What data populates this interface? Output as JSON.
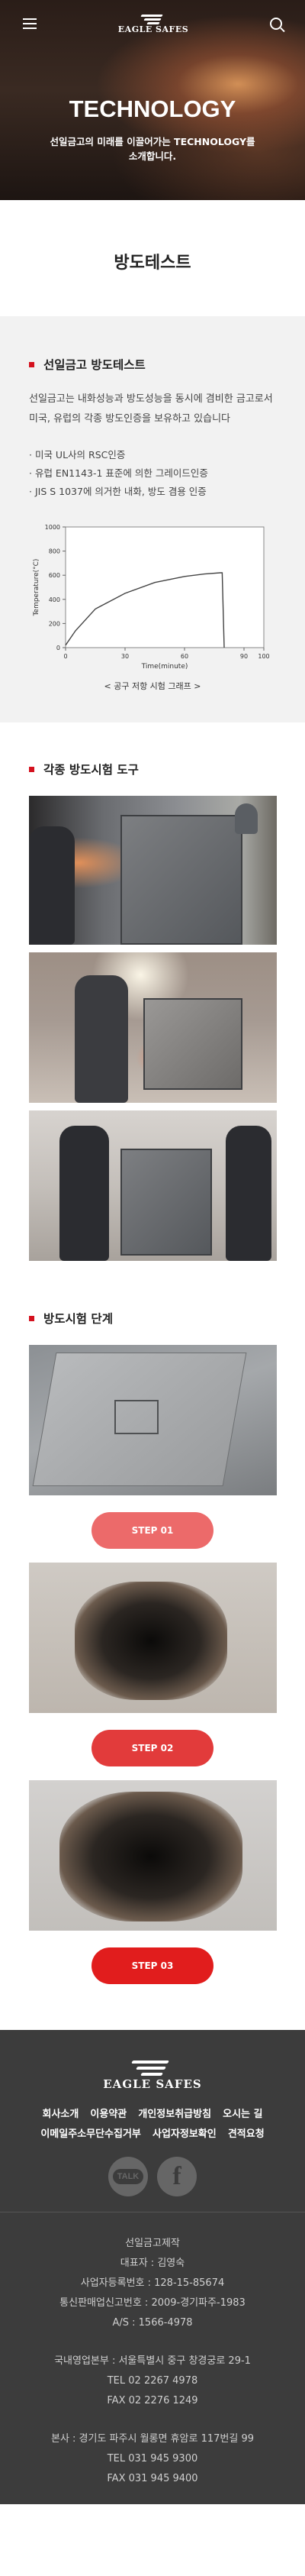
{
  "header": {
    "logo_text": "EAGLE SAFES"
  },
  "hero": {
    "title": "TECHNOLOGY",
    "subtitle": "선일금고의 미래를 이끌어가는 TECHNOLOGY를 소개합니다."
  },
  "page_title": "방도테스트",
  "section_test": {
    "heading": "선일금고 방도테스트",
    "description": "선일금고는 내화성능과 방도성능을 동시에 겸비한 금고로서 미국, 유럽의 각종 방도인증을 보유하고 있습니다",
    "bullets": [
      "미국 UL사의 RSC인증",
      "유럽 EN1143-1 표준에 의한 그레이드인증",
      "JIS S 1037에 의거한 내화, 방도 겸용 인증"
    ],
    "chart_caption": "< 공구 저항 시험 그래프 >"
  },
  "chart_data": {
    "type": "line",
    "title": "",
    "xlabel": "Time(minute)",
    "ylabel": "Temperature(°C)",
    "xlim": [
      0,
      100
    ],
    "ylim": [
      0,
      1000
    ],
    "x_ticks": [
      0,
      30,
      60,
      90,
      100
    ],
    "y_ticks": [
      0,
      200,
      400,
      600,
      800,
      1000
    ],
    "grid": false,
    "series": [
      {
        "values": [
          [
            0,
            20
          ],
          [
            5,
            140
          ],
          [
            15,
            320
          ],
          [
            30,
            450
          ],
          [
            45,
            540
          ],
          [
            60,
            590
          ],
          [
            70,
            610
          ],
          [
            78,
            620
          ],
          [
            79,
            620
          ],
          [
            80,
            0
          ]
        ]
      }
    ],
    "colors": {
      "line": "#444444"
    }
  },
  "section_tools": {
    "heading": "각종 방도시험 도구"
  },
  "section_steps": {
    "heading": "방도시험 단계",
    "steps": [
      {
        "label": "STEP 01"
      },
      {
        "label": "STEP 02"
      },
      {
        "label": "STEP 03"
      }
    ]
  },
  "footer": {
    "logo_text": "EAGLE SAFES",
    "links": [
      "회사소개",
      "이용약관",
      "개인정보취급방침",
      "오시는 길",
      "이메일주소무단수집거부",
      "사업자정보확인",
      "견적요청"
    ],
    "social": {
      "chat_label": "TALK",
      "fb_label": "f"
    },
    "info": [
      "선일금고제작",
      "대표자 : 김영숙",
      "사업자등록번호 : 128-15-85674",
      "통신판매업신고번호 : 2009-경기파주-1983",
      "A/S : 1566-4978"
    ],
    "hq": [
      "국내영업본부 : 서울특별시 중구 창경궁로 29-1",
      "TEL 02 2267 4978",
      "FAX 02 2276 1249"
    ],
    "head_office": [
      "본사 : 경기도 파주시 월롱면 휴암로 117번길 99",
      "TEL 031 945 9300",
      "FAX 031 945 9400"
    ]
  }
}
